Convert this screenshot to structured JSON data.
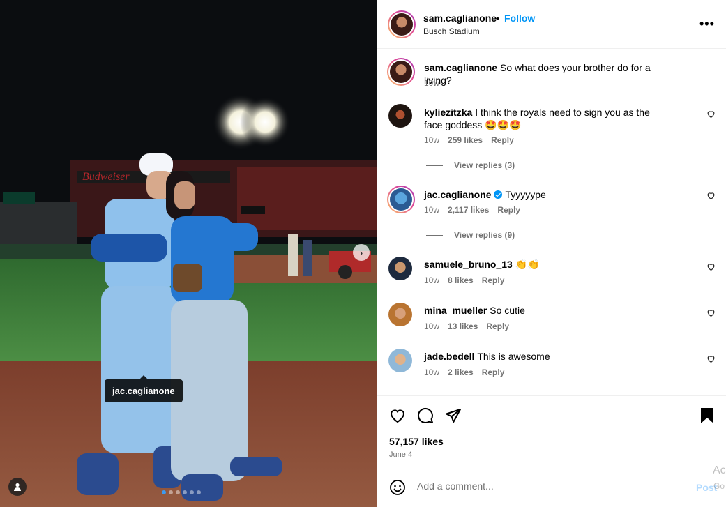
{
  "post": {
    "author": "sam.caglianone",
    "separator": "•",
    "follow_label": "Follow",
    "location": "Busch Stadium",
    "more_icon": "more-horizontal-icon"
  },
  "media": {
    "photo_description_tag": "jac.caglianone",
    "next_icon": "chevron-right-icon",
    "next_glyph": "›",
    "carousel_total": 6,
    "carousel_active": 1,
    "colors": {
      "sky": "#0b0d10",
      "field": "#3f7d3b",
      "dirt": "#8a4a34",
      "uniform": "#8fc1ec"
    }
  },
  "caption": {
    "user": "sam.caglianone",
    "text": "So what does your brother do for a living?",
    "time": "10w"
  },
  "comments": [
    {
      "user": "kyliezitzka",
      "text": "I think the royals need to sign you as the face goddess 🤩🤩🤩",
      "time": "10w",
      "likes": "259 likes",
      "reply": "Reply",
      "view_replies": "View replies (3)"
    },
    {
      "user": "jac.caglianone",
      "verified": true,
      "text": "Tyyyyype",
      "time": "10w",
      "likes": "2,117 likes",
      "reply": "Reply",
      "view_replies": "View replies (9)"
    },
    {
      "user": "samuele_bruno_13",
      "text": "👏👏",
      "time": "10w",
      "likes": "8 likes",
      "reply": "Reply"
    },
    {
      "user": "mina_mueller",
      "text": "So cutie",
      "time": "10w",
      "likes": "13 likes",
      "reply": "Reply"
    },
    {
      "user": "jade.bedell",
      "text": "This is awesome",
      "time": "10w",
      "likes": "2 likes",
      "reply": "Reply"
    }
  ],
  "stats": {
    "likes": "57,157 likes",
    "date": "June 4"
  },
  "composer": {
    "placeholder": "Add a comment...",
    "post_label": "Post"
  },
  "overlay": {
    "watermark_line1": "Ac",
    "watermark_line2": "Go"
  }
}
